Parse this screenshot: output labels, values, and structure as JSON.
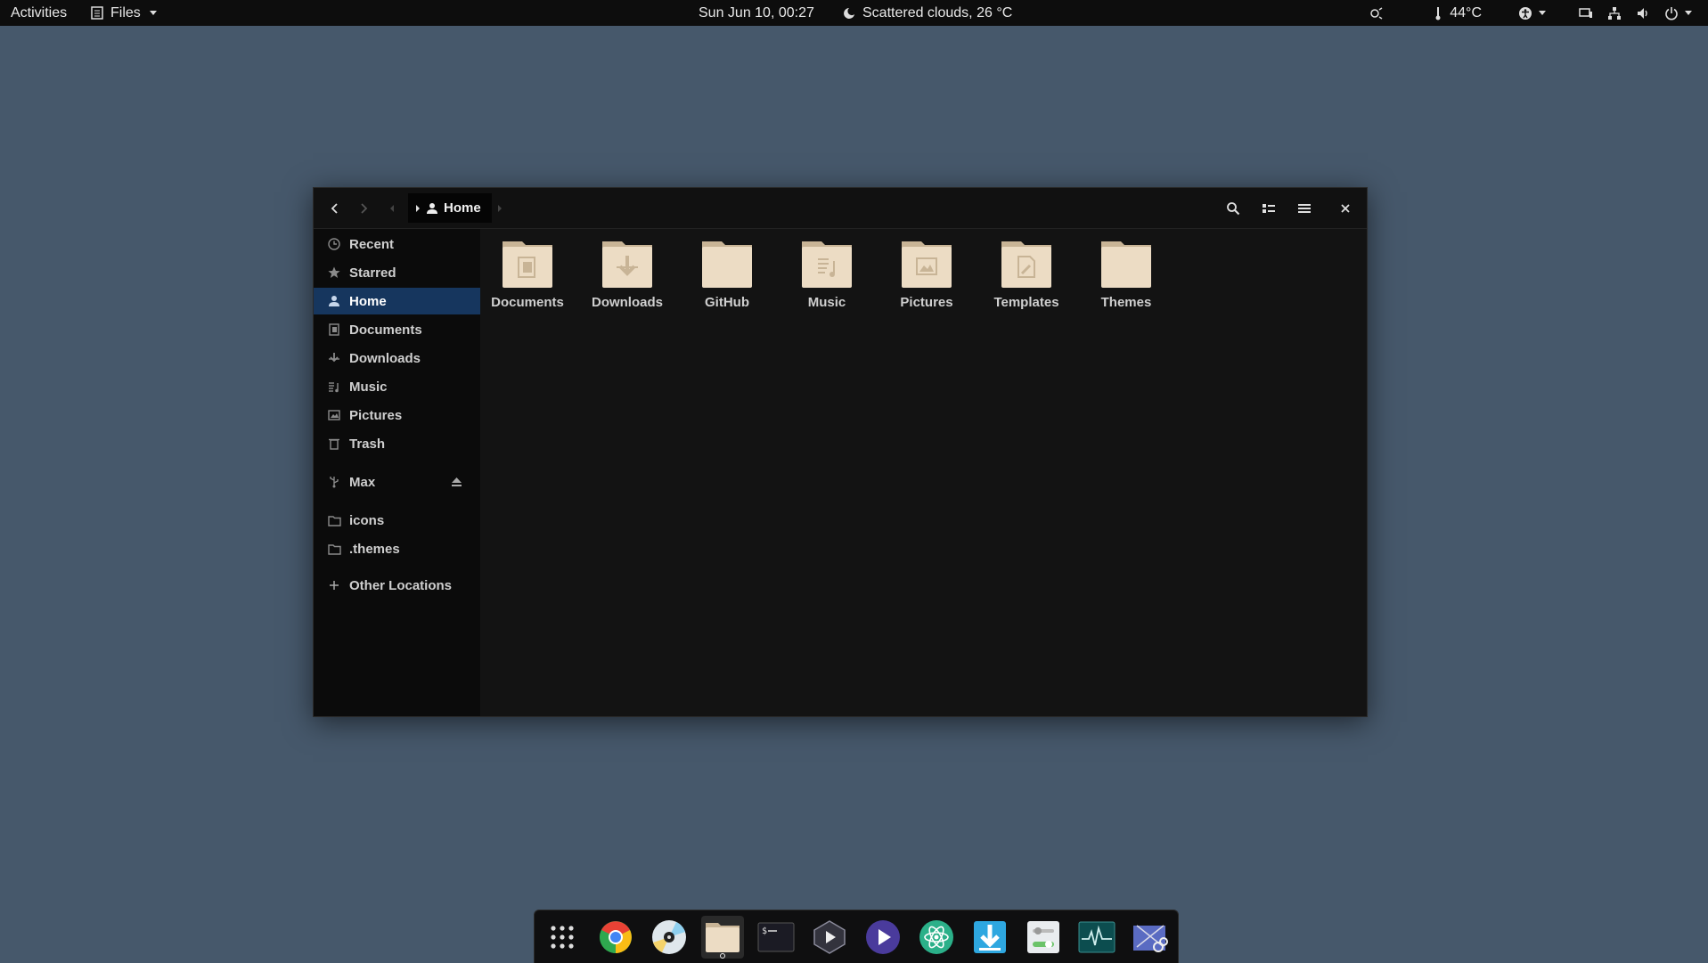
{
  "topbar": {
    "activities": "Activities",
    "app_name": "Files",
    "clock": "Sun Jun 10, 00:27",
    "weather": "Scattered clouds, 26 °C",
    "temperature": "44°C"
  },
  "window": {
    "breadcrumb": "Home"
  },
  "sidebar": {
    "items": [
      {
        "label": "Recent",
        "icon": "clock-icon"
      },
      {
        "label": "Starred",
        "icon": "star-icon"
      },
      {
        "label": "Home",
        "icon": "home-icon"
      },
      {
        "label": "Documents",
        "icon": "document-icon"
      },
      {
        "label": "Downloads",
        "icon": "download-icon"
      },
      {
        "label": "Music",
        "icon": "music-icon"
      },
      {
        "label": "Pictures",
        "icon": "picture-icon"
      },
      {
        "label": "Trash",
        "icon": "trash-icon"
      }
    ],
    "devices": [
      {
        "label": "Max",
        "icon": "usb-icon"
      }
    ],
    "bookmarks": [
      {
        "label": "icons",
        "icon": "folder-icon"
      },
      {
        "label": ".themes",
        "icon": "folder-icon"
      }
    ],
    "other": {
      "label": "Other Locations",
      "icon": "plus-icon"
    }
  },
  "folders": [
    {
      "label": "Documents",
      "icon": "documents-folder-icon"
    },
    {
      "label": "Downloads",
      "icon": "downloads-folder-icon"
    },
    {
      "label": "GitHub",
      "icon": "folder-icon"
    },
    {
      "label": "Music",
      "icon": "music-folder-icon"
    },
    {
      "label": "Pictures",
      "icon": "pictures-folder-icon"
    },
    {
      "label": "Templates",
      "icon": "templates-folder-icon"
    },
    {
      "label": "Themes",
      "icon": "folder-icon"
    }
  ],
  "dock": {
    "apps": [
      "show-apps-icon",
      "chrome-icon",
      "disks-icon",
      "files-icon",
      "terminal-icon",
      "video-editor-icon",
      "media-player-icon",
      "atom-icon",
      "downloader-icon",
      "settings-icon",
      "system-monitor-icon",
      "screenshot-icon"
    ]
  },
  "colors": {
    "desktop": "#46586b",
    "selection": "#16365e",
    "folder": "#ecdcc4",
    "folder_tab": "#c8b496"
  }
}
